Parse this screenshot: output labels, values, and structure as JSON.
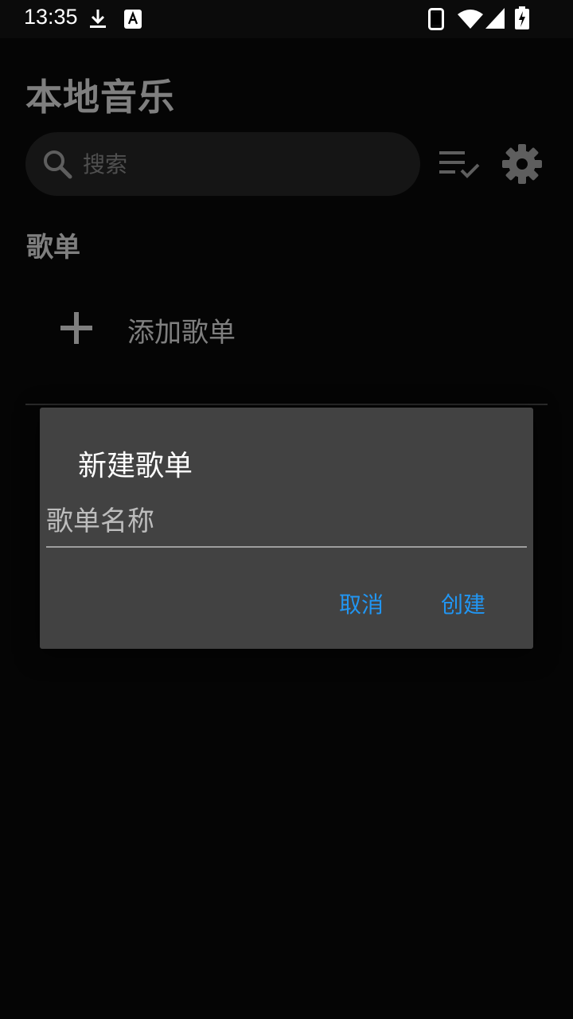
{
  "status_bar": {
    "time": "13:35",
    "icons": [
      "download-icon",
      "keyboard-a-icon",
      "phone-icon",
      "wifi-icon",
      "signal-icon",
      "battery-charging-icon"
    ]
  },
  "header": {
    "title": "本地音乐"
  },
  "search": {
    "placeholder": "搜索",
    "value": ""
  },
  "toolbar": {
    "icons": [
      "playlist-check-icon",
      "gear-icon"
    ]
  },
  "section": {
    "title": "歌单"
  },
  "add_playlist": {
    "label": "添加歌单"
  },
  "dialog": {
    "title": "新建歌单",
    "input_placeholder": "歌单名称",
    "input_value": "",
    "cancel_label": "取消",
    "create_label": "创建"
  },
  "colors": {
    "background": "#0b0b0b",
    "dialog_bg": "#424242",
    "accent": "#2196f3",
    "search_bg": "#2a2a2a"
  }
}
